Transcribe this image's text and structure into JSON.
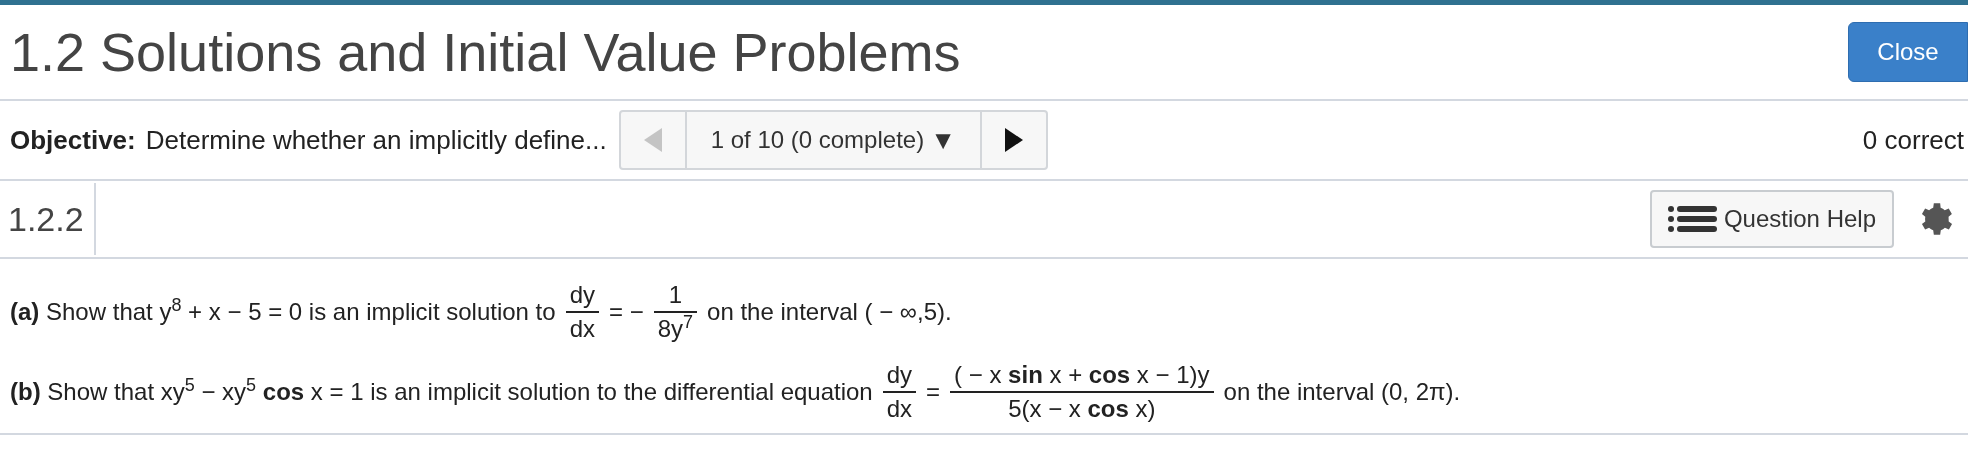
{
  "header": {
    "title": "1.2 Solutions and Initial Value Problems",
    "close_button": "Close"
  },
  "objective_bar": {
    "label": "Objective:",
    "text": "Determine whether an implicitly define...",
    "pager": {
      "previous_disabled": true,
      "position": "1 of 10 (0 complete)",
      "caret": "▼"
    },
    "score": "0 correct"
  },
  "question_bar": {
    "number": "1.2.2",
    "help_button": "Question Help"
  },
  "parts": [
    {
      "segments": [
        {
          "kind": "text",
          "text": "**(a)** Show that y$^{8}$ + x − 5 = 0 is an implicit solution to"
        },
        {
          "kind": "fraction",
          "numerator": "dy",
          "denominator": "dx"
        },
        {
          "kind": "text",
          "text": "= −"
        },
        {
          "kind": "fraction",
          "numerator": "1",
          "denominator": "8y$^{7}$"
        },
        {
          "kind": "text",
          "text": "on the interval ( − ∞,5)."
        }
      ]
    },
    {
      "segments": [
        {
          "kind": "text",
          "text": "**(b)** Show that xy$^{5}$ − xy$^{5}$ **cos** x = 1 is an implicit solution to the differential equation"
        },
        {
          "kind": "fraction",
          "numerator": "dy",
          "denominator": "dx"
        },
        {
          "kind": "text",
          "text": "="
        },
        {
          "kind": "fraction",
          "numerator": "( − x **sin** x + **cos** x − 1)y",
          "denominator": "5(x − x **cos** x)"
        },
        {
          "kind": "text",
          "text": "on the interval (0, 2π)."
        }
      ]
    }
  ]
}
